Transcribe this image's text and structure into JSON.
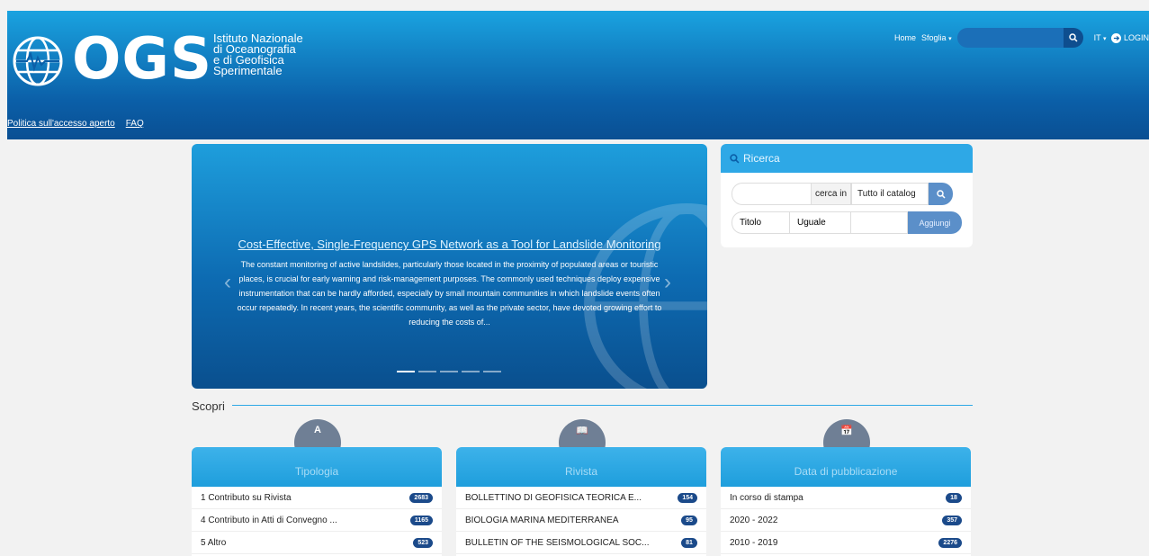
{
  "header": {
    "logo_text": "OGS",
    "logo_sub": [
      "Istituto Nazionale",
      "di Oceanografia",
      "e di Geofisica",
      "Sperimentale"
    ],
    "nav": {
      "home": "Home",
      "browse": "Sfoglia",
      "search_placeholder": "",
      "lang": "IT",
      "login": "LOGIN"
    },
    "subnav": [
      "Politica sull'accesso aperto",
      "FAQ"
    ]
  },
  "carousel": {
    "title": "Cost-Effective, Single-Frequency GPS Network as a Tool for Landslide Monitoring",
    "abstract": "The constant monitoring of active landslides, particularly those located in the proximity of populated areas or touristic places, is crucial for early warning and risk-management purposes. The commonly used techniques deploy expensive instrumentation that can be hardly afforded, especially by small mountain communities in which landslide events often occur repeatedly. In recent years, the scientific community, as well as the private sector, have devoted growing effort to reducing the costs of...",
    "slide_count": 5,
    "active_index": 0
  },
  "search": {
    "title": "Ricerca",
    "search_in_label": "cerca in",
    "scope": "Tutto il catalog",
    "field": "Titolo",
    "operator": "Uguale",
    "add_label": "Aggiungi"
  },
  "discover": {
    "title": "Scopri",
    "cards": [
      {
        "icon_glyph": "A",
        "title": "Tipologia",
        "items": [
          {
            "label": "1 Contributo su Rivista",
            "count": "2683"
          },
          {
            "label": "4 Contributo in Atti di Convegno ...",
            "count": "1165"
          },
          {
            "label": "5 Altro",
            "count": "523"
          }
        ]
      },
      {
        "icon_glyph": "📖",
        "title": "Rivista",
        "items": [
          {
            "label": "BOLLETTINO DI GEOFISICA TEORICA E...",
            "count": "154"
          },
          {
            "label": "BIOLOGIA MARINA MEDITERRANEA",
            "count": "95"
          },
          {
            "label": "BULLETIN OF THE SEISMOLOGICAL SOC...",
            "count": "81"
          }
        ]
      },
      {
        "icon_glyph": "📅",
        "title": "Data di pubblicazione",
        "items": [
          {
            "label": "In corso di stampa",
            "count": "18"
          },
          {
            "label": "2020 - 2022",
            "count": "357"
          },
          {
            "label": "2010 - 2019",
            "count": "2276"
          }
        ]
      }
    ]
  }
}
